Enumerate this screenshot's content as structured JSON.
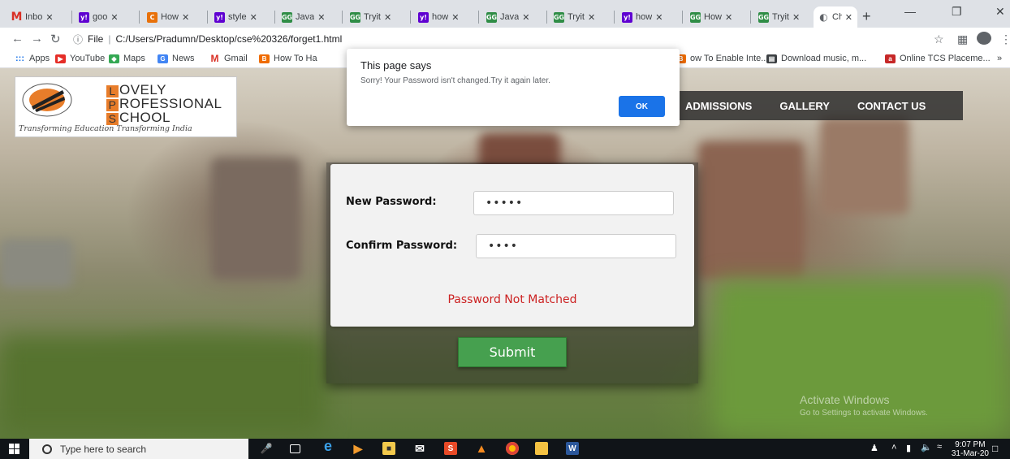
{
  "browser": {
    "tabs": [
      {
        "title": "Inbo",
        "favicon": "gmail-icon",
        "active": false
      },
      {
        "title": "goo",
        "favicon": "yahoo-icon",
        "active": false
      },
      {
        "title": "How",
        "favicon": "code-icon",
        "active": false
      },
      {
        "title": "style",
        "favicon": "yahoo-icon",
        "active": false
      },
      {
        "title": "Java",
        "favicon": "gfg-icon",
        "active": false
      },
      {
        "title": "Tryit",
        "favicon": "gfg-icon",
        "active": false
      },
      {
        "title": "how",
        "favicon": "yahoo-icon",
        "active": false
      },
      {
        "title": "Java",
        "favicon": "gfg-icon",
        "active": false
      },
      {
        "title": "Tryit",
        "favicon": "gfg-icon",
        "active": false
      },
      {
        "title": "how",
        "favicon": "yahoo-icon",
        "active": false
      },
      {
        "title": "How",
        "favicon": "gfg-icon",
        "active": false
      },
      {
        "title": "Tryit",
        "favicon": "gfg-icon",
        "active": false
      },
      {
        "title": "Cha",
        "favicon": "globe-icon",
        "active": true
      }
    ],
    "address": {
      "scheme_label": "File",
      "url": "C:/Users/Pradumn/Desktop/cse%20326/forget1.html"
    },
    "bookmarks": [
      {
        "label": "Apps",
        "icon": "apps-grid-icon"
      },
      {
        "label": "YouTube",
        "icon": "youtube-icon"
      },
      {
        "label": "Maps",
        "icon": "maps-icon"
      },
      {
        "label": "News",
        "icon": "news-icon"
      },
      {
        "label": "Gmail",
        "icon": "gmail-icon"
      },
      {
        "label": "How To Ha",
        "icon": "bookmark-icon"
      },
      {
        "label": "ow To Enable Inte...",
        "icon": "bookmark-icon"
      },
      {
        "label": "Download music, m...",
        "icon": "download-icon"
      },
      {
        "label": "Online TCS Placeme...",
        "icon": "tcs-icon"
      }
    ],
    "more_bookmarks": "»"
  },
  "alert": {
    "title": "This page says",
    "message": "Sorry! Your Password isn't changed.Try it again later.",
    "ok_label": "OK"
  },
  "site": {
    "logo": {
      "line1_letter": "L",
      "line1_rest": "OVELY",
      "line2_letter": "P",
      "line2_rest": "ROFESSIONAL",
      "line3_letter": "S",
      "line3_rest": "CHOOL",
      "tagline": "Transforming Education Transforming India"
    },
    "nav": [
      "ADMISSIONS",
      "GALLERY",
      "CONTACT US"
    ],
    "form": {
      "new_password_label": "New Password:",
      "new_password_value": "•••••",
      "confirm_password_label": "Confirm Password:",
      "confirm_password_value": "••••",
      "error_message": "Password Not Matched",
      "submit_label": "Submit"
    },
    "watermark": {
      "line1": "Activate Windows",
      "line2": "Go to Settings to activate Windows."
    }
  },
  "taskbar": {
    "search_placeholder": "Type here to search",
    "time": "9:07 PM",
    "date": "31-Mar-20"
  },
  "colors": {
    "alert_ok": "#1a73e8",
    "submit_green": "#46a04f",
    "error_red": "#cc2222",
    "nav_bar": "#282828"
  }
}
